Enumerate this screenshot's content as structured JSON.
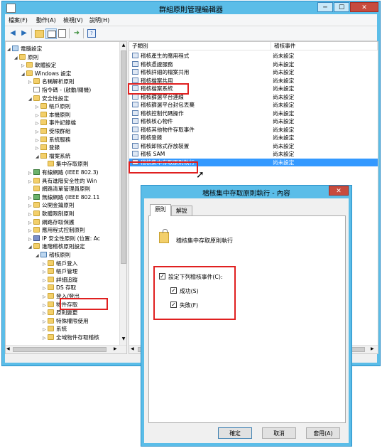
{
  "window": {
    "title": "群組原則管理編輯器",
    "min": "─",
    "max": "☐",
    "close": "✕"
  },
  "menu": [
    "檔案(F)",
    "動作(A)",
    "檢視(V)",
    "說明(H)"
  ],
  "tree": [
    {
      "label": "電腦設定",
      "icon": "computer-icon",
      "arrow": "◢"
    },
    {
      "label": "原則",
      "icon": "folder-icon",
      "arrow": "◢"
    },
    {
      "label": "軟體設定",
      "icon": "folder-icon",
      "arrow": "▷"
    },
    {
      "label": "Windows 設定",
      "icon": "folder-icon",
      "arrow": "◢"
    },
    {
      "label": "名稱解析原則",
      "icon": "folder-icon",
      "arrow": "▷"
    },
    {
      "label": "指令碼 - (啟動/關機)",
      "icon": "scroll-icon",
      "arrow": ""
    },
    {
      "label": "安全性設定",
      "icon": "security-folder-icon",
      "arrow": "◢"
    },
    {
      "label": "帳戶原則",
      "icon": "folder-icon",
      "arrow": "▷"
    },
    {
      "label": "本機原則",
      "icon": "folder-icon",
      "arrow": "▷"
    },
    {
      "label": "事件記錄檔",
      "icon": "folder-icon",
      "arrow": "▷"
    },
    {
      "label": "受限群組",
      "icon": "lock-folder-icon",
      "arrow": "▷"
    },
    {
      "label": "系統服務",
      "icon": "lock-folder-icon",
      "arrow": "▷"
    },
    {
      "label": "登錄",
      "icon": "lock-folder-icon",
      "arrow": "▷"
    },
    {
      "label": "檔案系統",
      "icon": "lock-folder-icon",
      "arrow": "◢"
    },
    {
      "label": "集中存取原則",
      "icon": "folder-icon",
      "arrow": ""
    },
    {
      "label": "有線網路 (IEEE 802.3)",
      "icon": "network-icon",
      "arrow": "▷"
    },
    {
      "label": "具有進階安全性的 Win",
      "icon": "folder-icon",
      "arrow": "▷"
    },
    {
      "label": "網路清單管理員原則",
      "icon": "folder-icon",
      "arrow": ""
    },
    {
      "label": "無線網路 (IEEE 802.11",
      "icon": "network-icon",
      "arrow": "▷"
    },
    {
      "label": "公開金鑰原則",
      "icon": "folder-icon",
      "arrow": "▷"
    },
    {
      "label": "軟體限制原則",
      "icon": "folder-icon",
      "arrow": "▷"
    },
    {
      "label": "網路存取保護",
      "icon": "folder-icon",
      "arrow": "▷"
    },
    {
      "label": "應用程式控制原則",
      "icon": "folder-icon",
      "arrow": "▷"
    },
    {
      "label": "IP 安全性原則 (位置: Ac",
      "icon": "shield-icon",
      "arrow": "▷"
    },
    {
      "label": "進階稽核原則設定",
      "icon": "folder-icon",
      "arrow": "◢"
    },
    {
      "label": "稽核原則",
      "icon": "audit-icon",
      "arrow": "◢"
    },
    {
      "label": "帳戶登入",
      "icon": "folder-icon",
      "arrow": "▷"
    },
    {
      "label": "帳戶管理",
      "icon": "folder-icon",
      "arrow": "▷"
    },
    {
      "label": "詳細追蹤",
      "icon": "folder-icon",
      "arrow": "▷"
    },
    {
      "label": "DS 存取",
      "icon": "folder-icon",
      "arrow": "▷"
    },
    {
      "label": "登入/登出",
      "icon": "folder-icon",
      "arrow": "▷"
    },
    {
      "label": "物件存取",
      "icon": "folder-icon",
      "arrow": "▷"
    },
    {
      "label": "原則變更",
      "icon": "folder-icon",
      "arrow": "▷"
    },
    {
      "label": "特殊權限使用",
      "icon": "folder-icon",
      "arrow": "▷"
    },
    {
      "label": "系統",
      "icon": "folder-icon",
      "arrow": "▷"
    },
    {
      "label": "全域物件存取稽核",
      "icon": "folder-icon",
      "arrow": "▷"
    }
  ],
  "list": {
    "col_name": "子類別",
    "col_value": "稽核事件",
    "rows": [
      {
        "name": "稽核產生的應用程式",
        "value": "尚未設定"
      },
      {
        "name": "稽核憑證服務",
        "value": "尚未設定"
      },
      {
        "name": "稽核詳細的檔案共用",
        "value": "尚未設定"
      },
      {
        "name": "稽核檔案共用",
        "value": "尚未設定"
      },
      {
        "name": "稽核檔案系統",
        "value": "尚未設定"
      },
      {
        "name": "稽核篩選平台連線",
        "value": "尚未設定"
      },
      {
        "name": "稽核篩選平台封包丟棄",
        "value": "尚未設定"
      },
      {
        "name": "稽核控制代碼操作",
        "value": "尚未設定"
      },
      {
        "name": "稽核核心物件",
        "value": "尚未設定"
      },
      {
        "name": "稽核其他物件存取事件",
        "value": "尚未設定"
      },
      {
        "name": "稽核登錄",
        "value": "尚未設定"
      },
      {
        "name": "稽核卸除式存放裝置",
        "value": "尚未設定"
      },
      {
        "name": "稽核 SAM",
        "value": "尚未設定"
      },
      {
        "name": "稽核集中存取原則執行",
        "value": "尚未設定"
      }
    ]
  },
  "dialog": {
    "title": "稽核集中存取原則執行 - 內容",
    "close": "✕",
    "tabs": [
      "原則",
      "解說"
    ],
    "policy_name": "稽核集中存取原則執行",
    "configure_label": "設定下列稽核事件(C):",
    "success_label": "成功(S)",
    "failure_label": "失敗(F)",
    "checked": "✓",
    "ok": "確定",
    "cancel": "取消",
    "apply": "套用(A)"
  }
}
